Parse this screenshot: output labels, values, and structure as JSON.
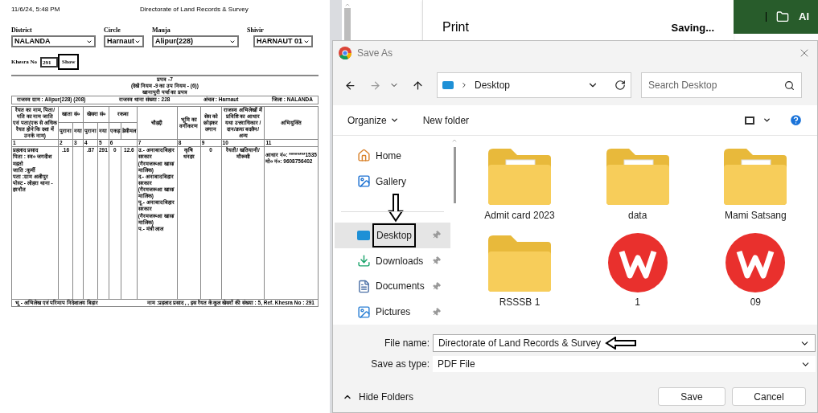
{
  "document": {
    "timestamp": "11/6/24, 5:48 PM",
    "header_title": "Directorate of Land Records & Survey",
    "filters": [
      {
        "label": "District",
        "value": "NALANDA"
      },
      {
        "label": "Circle",
        "value": "Harnaut"
      },
      {
        "label": "Mauja",
        "value": "Alipur(228)"
      },
      {
        "label": "Shivir",
        "value": "HARNAUT 01"
      }
    ],
    "khesra": {
      "label": "Khesra No",
      "value": "291",
      "button": "Show"
    },
    "form": {
      "heading": [
        "प्रपत्र -7",
        "(देखें नियम -9 का उप नियम - (6))",
        "खानापुरी पर्चा का प्रपत्र"
      ],
      "info": [
        "राजस्व ग्राम : Alipur(228) (208)",
        "राजस्व थाना संख्या : 228",
        "अंचल : Harnaut",
        "जिला : NALANDA"
      ],
      "columns": [
        {
          "label": "रैयत का नाम, पिता/ पति का नाम जाति एवं पता(एक से अधिक रैयत होने कि दशा में उनके नाम)"
        },
        {
          "label": "खाता सं०",
          "children": [
            "पुराना",
            "नया"
          ]
        },
        {
          "label": "खेसरा सं०",
          "children": [
            "पुराना",
            "नया"
          ]
        },
        {
          "label": "रकबा",
          "children": [
            "एकड़",
            "डेसीमल"
          ]
        },
        {
          "label": "चौहद्दी"
        },
        {
          "label": "भूमि का वर्गीकरण"
        },
        {
          "label": "सेस को छोड़कर लगान"
        },
        {
          "label": "राजस्व अभिलेखों में प्रविष्टि का आधार यथा उत्तराधिकार /दान/क्रय/ बदलैन/अन्य"
        },
        {
          "label": "अभियुक्ति"
        }
      ],
      "numbers": [
        "1",
        "2",
        "3",
        "4",
        "5",
        "6",
        "7",
        "8",
        "9",
        "10",
        "11"
      ],
      "row": {
        "owner": [
          "प्रहलाद प्रसाद",
          "पिता : स्व० जगदीश महतो",
          "जाति :कुर्मी",
          "पता :ग्राम अलीपुर पोस्ट - लोहरा थाना - हरनौत"
        ],
        "khata": {
          "old": ".16"
        },
        "khesra": {
          "old": ".87",
          "new": "291"
        },
        "area": {
          "acre": "0",
          "decimal": "12.6"
        },
        "boundaries": [
          "उ.- अनाबाद बिहार सरकार (गैरमजरूआ खास/मालिक)",
          "द.- अनाबाद बिहार सरकार (गैरमजरूआ खास/मालिक)",
          "पू.- अनाबाद बिहार सरकार (गैरमजरूआ खास/मालिक)",
          "प.- मंत्री लाल"
        ],
        "classification": "कृषि धनहर",
        "rent": "0",
        "basis": "रैयती/ खतियानी/ मौरूसी",
        "remarks": [
          "आधार नं०: ********1535",
          "मो० नं०: 9608756402"
        ]
      },
      "footer_left": "भू - अभिलेख एवं परिमाप निदेशालय बिहार",
      "footer_right": "नाम :प्रहलाद प्रसाद , , इस रैयत के कुल खेसरों की संख्या : 5, Ref. Khesra No : 291"
    }
  },
  "print_panel": {
    "title": "Print",
    "status": "Saving..."
  },
  "side_bar": {
    "label": "Al"
  },
  "dialog": {
    "title": "Save As",
    "address": "Desktop",
    "search_placeholder": "Search Desktop",
    "toolbar": {
      "organize": "Organize",
      "new_folder": "New folder"
    },
    "nav_items": [
      {
        "label": "Home",
        "selected": false,
        "pinned": false
      },
      {
        "label": "Gallery",
        "selected": false,
        "pinned": false
      },
      {
        "label": "Desktop",
        "selected": true,
        "pinned": true
      },
      {
        "label": "Downloads",
        "selected": false,
        "pinned": true
      },
      {
        "label": "Documents",
        "selected": false,
        "pinned": true
      },
      {
        "label": "Pictures",
        "selected": false,
        "pinned": true
      }
    ],
    "files": [
      {
        "name": "Admit card 2023",
        "kind": "folder",
        "has_preview": true
      },
      {
        "name": "data",
        "kind": "folder",
        "has_preview": true
      },
      {
        "name": "Mami Satsang",
        "kind": "folder",
        "has_preview": true
      },
      {
        "name": "RSSSB 1",
        "kind": "folder",
        "has_preview": false
      },
      {
        "name": "1",
        "kind": "app"
      },
      {
        "name": "09",
        "kind": "app"
      }
    ],
    "file_name": {
      "label": "File name:",
      "value": "Directorate of Land Records & Survey"
    },
    "file_type": {
      "label": "Save as type:",
      "value": "PDF File"
    },
    "hide_folders": "Hide Folders",
    "save": "Save",
    "cancel": "Cancel"
  }
}
